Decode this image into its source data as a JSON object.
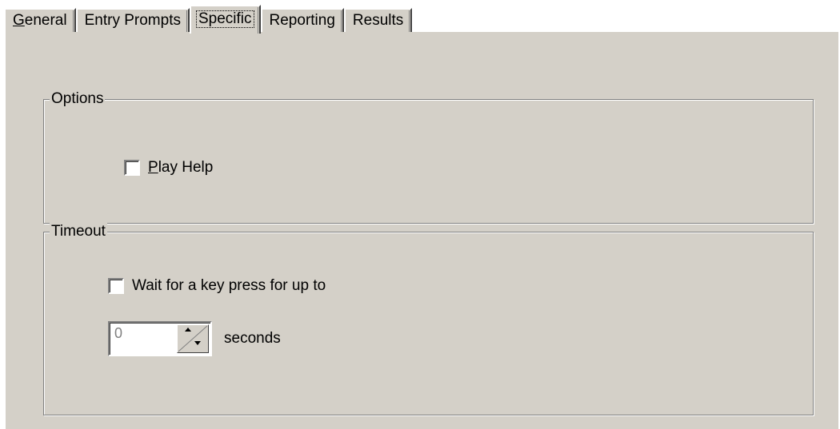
{
  "tabs": [
    {
      "label_ul": "G",
      "label_rest": "eneral",
      "active": false
    },
    {
      "label_ul": "",
      "label_rest": "Entry Prompts",
      "active": false
    },
    {
      "label_ul": "",
      "label_rest": "Specific",
      "active": true
    },
    {
      "label_ul": "",
      "label_rest": "Reporting",
      "active": false
    },
    {
      "label_ul": "",
      "label_rest": "Results",
      "active": false
    }
  ],
  "options_group": {
    "title": "Options",
    "play_help": {
      "mnemonic": "P",
      "label_rest": "lay Help",
      "checked": false
    }
  },
  "timeout_group": {
    "title": "Timeout",
    "wait_key": {
      "label": "Wait for a key press for up to",
      "checked": false
    },
    "seconds_value": "0",
    "seconds_label": "seconds"
  },
  "icons": {
    "spinner": "up-down-arrows-icon"
  },
  "colors": {
    "face": "#d4d0c8",
    "disabled_text": "#808080"
  }
}
